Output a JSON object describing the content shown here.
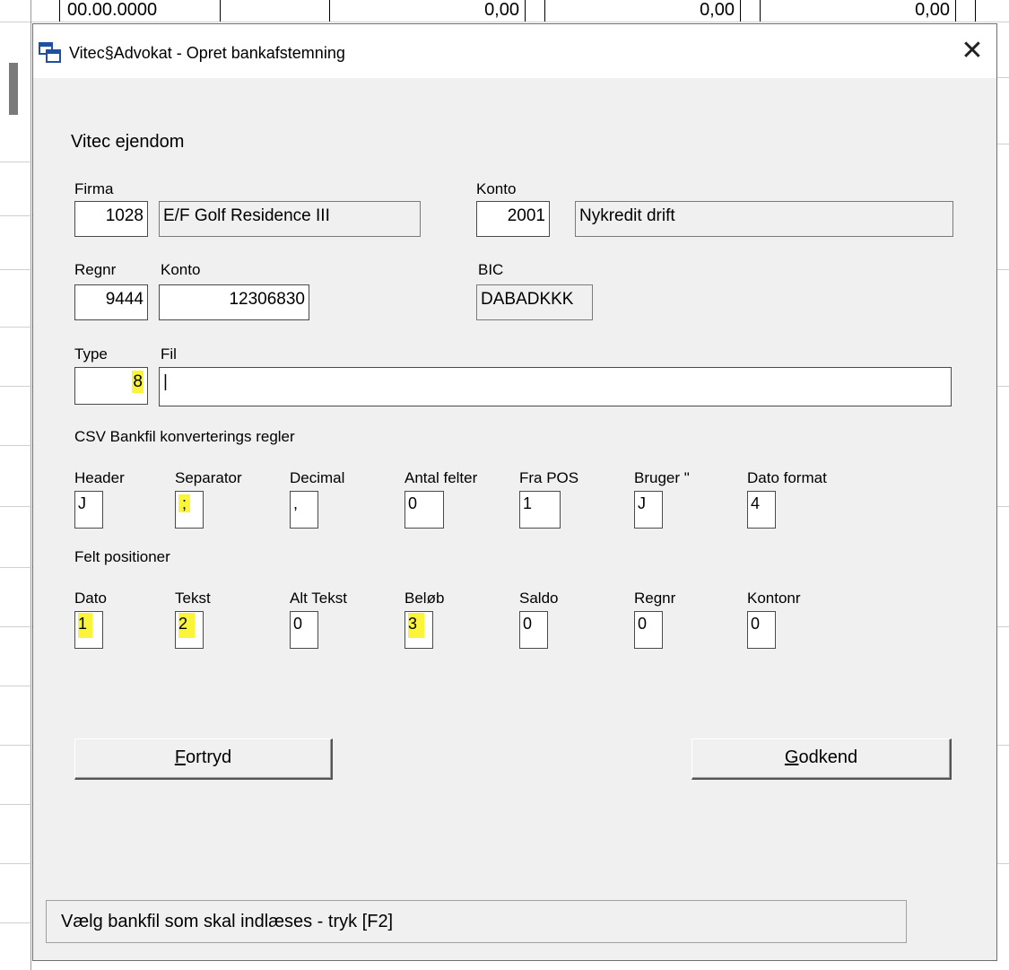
{
  "background": {
    "date_cell": "00.00.0000",
    "amount_cells": [
      "0,00",
      "0,00",
      "0,00"
    ]
  },
  "window": {
    "title": "Vitec§Advokat - Opret bankafstemning",
    "close_glyph": "✕"
  },
  "section_title": "Vitec ejendom",
  "firma": {
    "label": "Firma",
    "number": "1028",
    "name": "E/F Golf Residence III"
  },
  "konto_top": {
    "label": "Konto",
    "number": "2001",
    "name": "Nykredit drift"
  },
  "regnr": {
    "label": "Regnr",
    "value": "9444"
  },
  "konto": {
    "label": "Konto",
    "value": "12306830"
  },
  "bic": {
    "label": "BIC",
    "value": "DABADKKK"
  },
  "type": {
    "label": "Type",
    "value": "8"
  },
  "fil": {
    "label": "Fil",
    "value": "|"
  },
  "csv_rules": {
    "title": "CSV Bankfil konverterings regler",
    "fields": [
      {
        "label": "Header",
        "value": "J"
      },
      {
        "label": "Separator",
        "value": ";"
      },
      {
        "label": "Decimal",
        "value": ","
      },
      {
        "label": "Antal felter",
        "value": "0"
      },
      {
        "label": "Fra POS",
        "value": "1"
      },
      {
        "label": "Bruger \"",
        "value": "J"
      },
      {
        "label": "Dato format",
        "value": "4"
      }
    ]
  },
  "field_positions": {
    "title": "Felt positioner",
    "fields": [
      {
        "label": "Dato",
        "value": "1"
      },
      {
        "label": "Tekst",
        "value": "2"
      },
      {
        "label": "Alt Tekst",
        "value": "0"
      },
      {
        "label": "Beløb",
        "value": "3"
      },
      {
        "label": "Saldo",
        "value": "0"
      },
      {
        "label": "Regnr",
        "value": "0"
      },
      {
        "label": "Kontonr",
        "value": "0"
      }
    ]
  },
  "buttons": {
    "cancel": {
      "mnemonic": "F",
      "rest": "ortryd"
    },
    "approve": {
      "mnemonic": "G",
      "rest": "odkend"
    }
  },
  "status": "Vælg bankfil som skal indlæses - tryk [F2]",
  "colors": {
    "highlight": "#fbf53a",
    "dialog_bg": "#f0f0f0"
  }
}
